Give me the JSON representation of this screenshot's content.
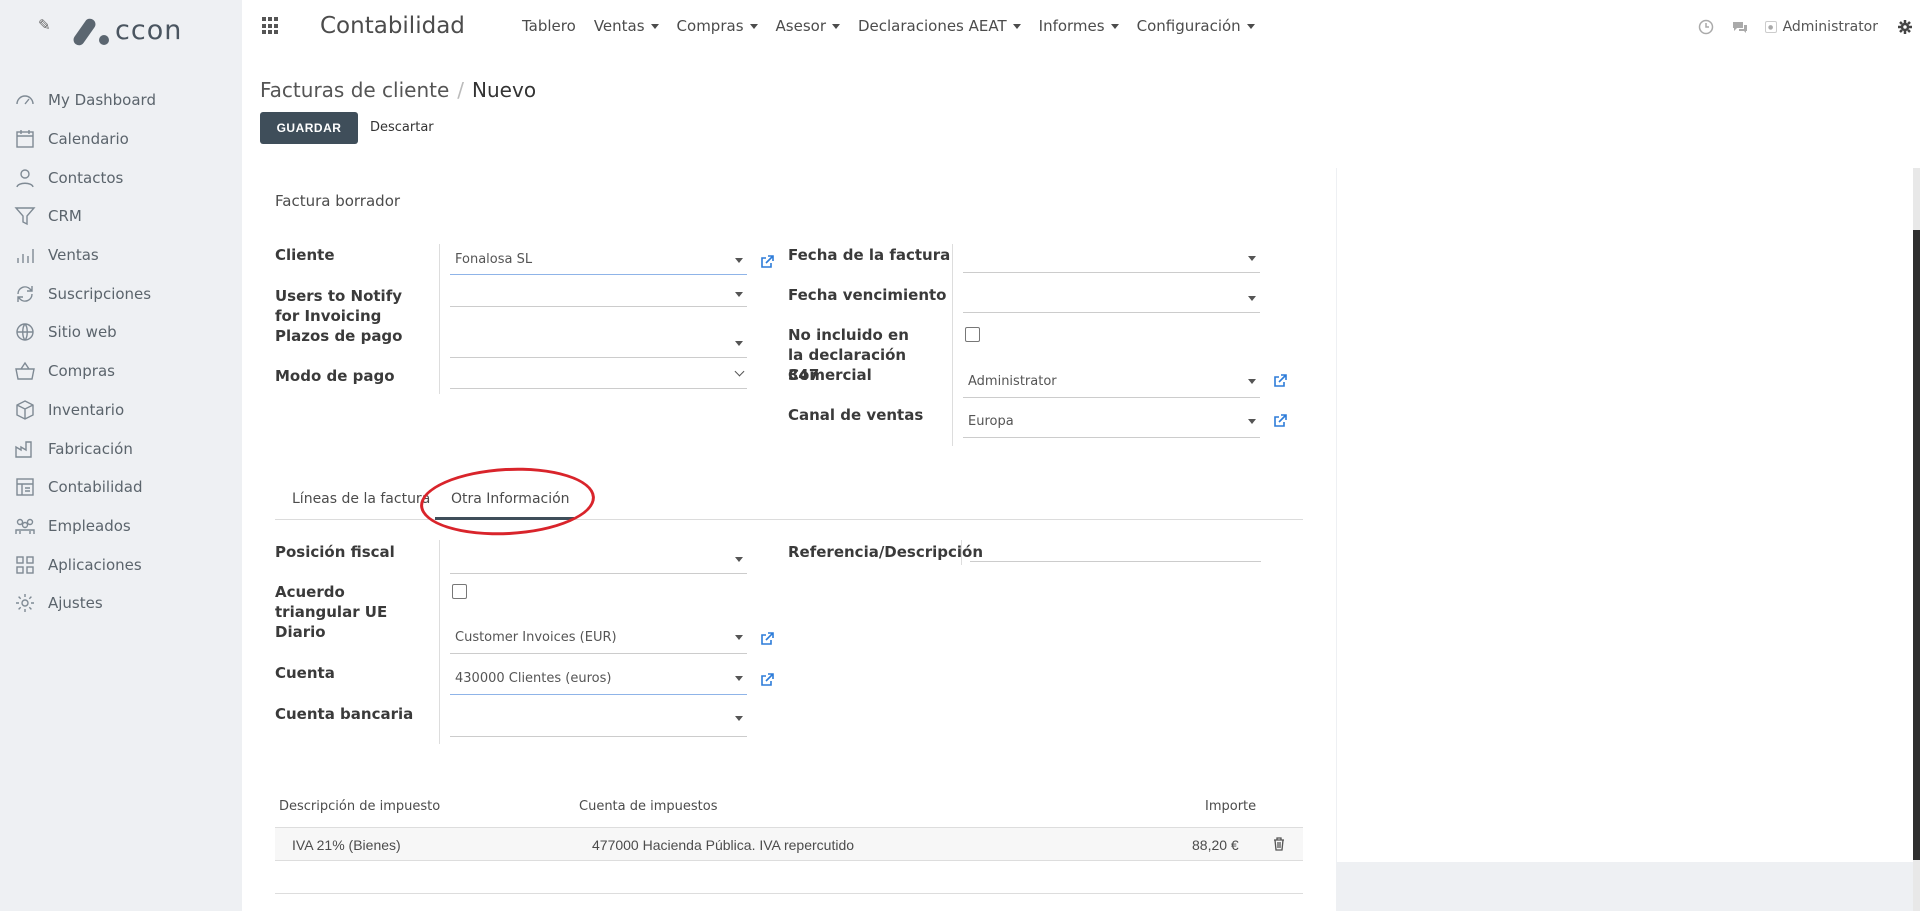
{
  "sidebar": {
    "logo_text": "ccon",
    "items": [
      {
        "label": "My Dashboard",
        "icon": "dashboard-icon"
      },
      {
        "label": "Calendario",
        "icon": "calendar-icon"
      },
      {
        "label": "Contactos",
        "icon": "user-icon"
      },
      {
        "label": "CRM",
        "icon": "funnel-icon"
      },
      {
        "label": "Ventas",
        "icon": "bar-chart-icon"
      },
      {
        "label": "Suscripciones",
        "icon": "refresh-icon"
      },
      {
        "label": "Sitio web",
        "icon": "globe-icon"
      },
      {
        "label": "Compras",
        "icon": "basket-icon"
      },
      {
        "label": "Inventario",
        "icon": "box-icon"
      },
      {
        "label": "Fabricación",
        "icon": "factory-icon"
      },
      {
        "label": "Contabilidad",
        "icon": "accounting-icon"
      },
      {
        "label": "Empleados",
        "icon": "people-icon"
      },
      {
        "label": "Aplicaciones",
        "icon": "apps-grid-icon"
      },
      {
        "label": "Ajustes",
        "icon": "gear-icon"
      }
    ]
  },
  "topbar": {
    "app_title": "Contabilidad",
    "nav": [
      {
        "label": "Tablero",
        "dropdown": false
      },
      {
        "label": "Ventas",
        "dropdown": true
      },
      {
        "label": "Compras",
        "dropdown": true
      },
      {
        "label": "Asesor",
        "dropdown": true
      },
      {
        "label": "Declaraciones AEAT",
        "dropdown": true
      },
      {
        "label": "Informes",
        "dropdown": true
      },
      {
        "label": "Configuración",
        "dropdown": true
      }
    ],
    "user": "Administrator"
  },
  "control": {
    "breadcrumb_parent": "Facturas de cliente",
    "breadcrumb_sep": "/",
    "breadcrumb_current": "Nuevo",
    "save_label": "GUARDAR",
    "discard_label": "Descartar"
  },
  "form": {
    "status_title": "Factura borrador",
    "left": {
      "cliente_label": "Cliente",
      "cliente_value": "Fonalosa SL",
      "users_notify_label": "Users to Notify for Invoicing",
      "plazos_label": "Plazos de pago",
      "modo_label": "Modo de pago"
    },
    "right": {
      "fecha_factura_label": "Fecha de la factura",
      "fecha_venc_label": "Fecha vencimiento",
      "no_incluido_label": "No incluido en la declaración 347",
      "comercial_label": "Comercial",
      "comercial_value": "Administrator",
      "canal_label": "Canal de ventas",
      "canal_value": "Europa"
    },
    "tabs": [
      {
        "label": "Líneas de la factura",
        "active": false
      },
      {
        "label": "Otra Información",
        "active": true
      }
    ],
    "other": {
      "posicion_label": "Posición fiscal",
      "acuerdo_label": "Acuerdo triangular UE",
      "diario_label": "Diario",
      "diario_value": "Customer Invoices (EUR)",
      "cuenta_label": "Cuenta",
      "cuenta_value": "430000 Clientes (euros)",
      "cuenta_bancaria_label": "Cuenta bancaria",
      "referencia_label": "Referencia/Descripción"
    },
    "tax_table": {
      "headers": [
        "Descripción de impuesto",
        "Cuenta de impuestos",
        "Importe"
      ],
      "rows": [
        {
          "descripcion": "IVA 21% (Bienes)",
          "cuenta": "477000 Hacienda Pública. IVA repercutido",
          "importe": "88,20 €"
        }
      ]
    }
  },
  "colors": {
    "primary": "#3f4e5a",
    "link": "#2d7cd9",
    "annotation": "#d9242b",
    "sidebar_bg": "#eef0f3"
  }
}
